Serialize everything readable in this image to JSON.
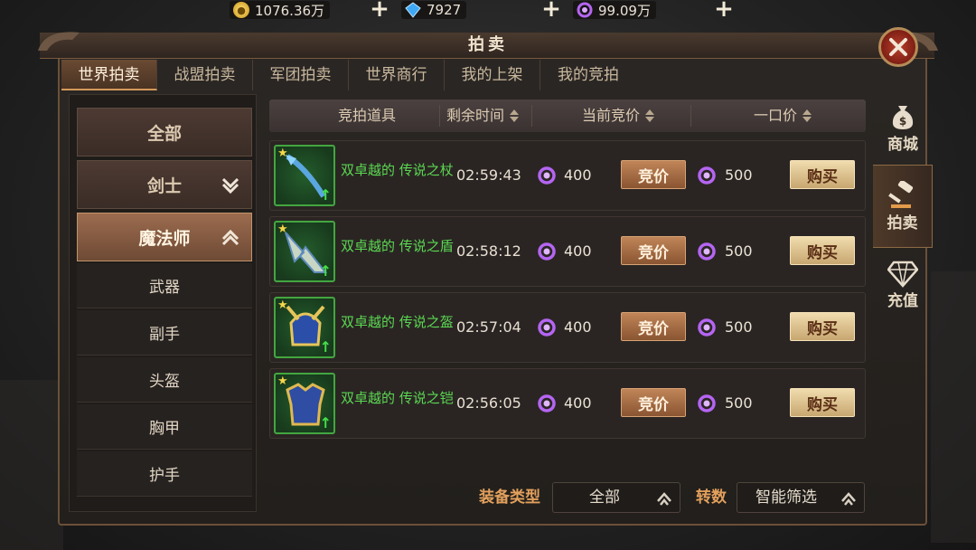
{
  "currency": [
    {
      "icon": "gold-coin-icon",
      "value": "1076.36万"
    },
    {
      "icon": "diamond-icon",
      "value": "7927"
    },
    {
      "icon": "purple-gem-icon",
      "value": "99.09万"
    }
  ],
  "title": "拍卖",
  "tabs": [
    "世界拍卖",
    "战盟拍卖",
    "军团拍卖",
    "世界商行",
    "我的上架",
    "我的竞拍"
  ],
  "active_tab": "世界拍卖",
  "side_nav": [
    {
      "label": "商城",
      "icon": "money-bag-icon"
    },
    {
      "label": "拍卖",
      "icon": "gavel-icon"
    },
    {
      "label": "充值",
      "icon": "diamond-icon"
    }
  ],
  "categories": [
    {
      "label": "全部"
    },
    {
      "label": "剑士",
      "arrow": "chevron-down-icon"
    },
    {
      "label": "魔法师",
      "arrow": "chevron-up-icon"
    }
  ],
  "subcategories": [
    "武器",
    "副手",
    "头盔",
    "胸甲",
    "护手"
  ],
  "table": {
    "headers": [
      "竞拍道具",
      "剩余时间",
      "当前竞价",
      "一口价"
    ],
    "bid_label": "竞价",
    "buy_label": "购买",
    "rows": [
      {
        "name": "双卓越的 传说之杖",
        "time": "02:59:43",
        "bid": "400",
        "buyout": "500",
        "icon": "staff-icon"
      },
      {
        "name": "双卓越的 传说之盾",
        "time": "02:58:12",
        "bid": "400",
        "buyout": "500",
        "icon": "shield-icon"
      },
      {
        "name": "双卓越的 传说之盔",
        "time": "02:57:04",
        "bid": "400",
        "buyout": "500",
        "icon": "helmet-icon"
      },
      {
        "name": "双卓越的 传说之铠",
        "time": "02:56:05",
        "bid": "400",
        "buyout": "500",
        "icon": "armor-icon"
      }
    ]
  },
  "filters": {
    "type_label": "装备类型",
    "type_value": "全部",
    "rank_label": "转数",
    "rank_value": "智能筛选"
  },
  "colors": {
    "item_name": "#5bd852",
    "filter_label": "#e3a05c",
    "bid_button": "#a86c44",
    "buy_button": "#e2c690"
  }
}
